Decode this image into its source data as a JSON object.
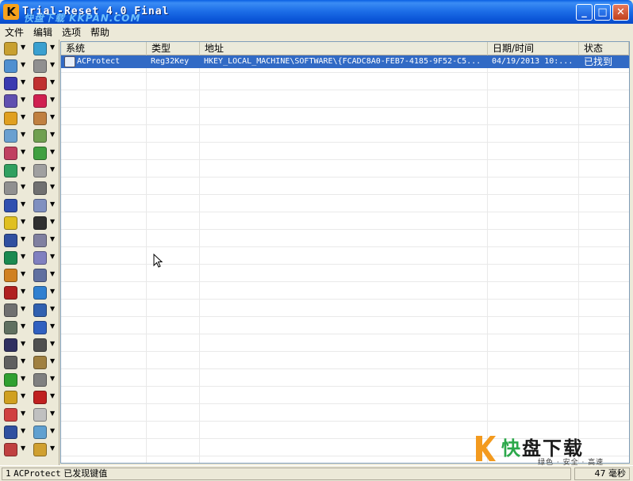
{
  "window": {
    "title": "Trial-Reset 4.0 Final",
    "watermark": "快盘下载 KKPAN.COM",
    "controls": {
      "minimize": "_",
      "maximize": "□",
      "close": "✕"
    }
  },
  "menu": [
    "文件",
    "编辑",
    "选项",
    "帮助"
  ],
  "toolbar": {
    "icon_colors": [
      "#c8a030",
      "#3aa0d0",
      "#5090d0",
      "#909090",
      "#3a3ab0",
      "#c03030",
      "#6050b0",
      "#d02050",
      "#e0a020",
      "#c08040",
      "#6aa0d0",
      "#70a050",
      "#c04060",
      "#40a040",
      "#30a060",
      "#a0a0a0",
      "#909090",
      "#707070",
      "#3050b0",
      "#8090c0",
      "#e0c020",
      "#303030",
      "#3050a0",
      "#8080a0",
      "#1a8a50",
      "#8080c0",
      "#d08020",
      "#6070a0",
      "#b02020",
      "#3080d0",
      "#707070",
      "#3060b0",
      "#607060",
      "#3060c0",
      "#303060",
      "#505050",
      "#606060",
      "#a08040",
      "#30a030",
      "#808080",
      "#d0a020",
      "#c02020",
      "#d04040",
      "#c0c0c0",
      "#3050a0",
      "#60a0d0",
      "#c04040",
      "#d0a030"
    ]
  },
  "list": {
    "columns": [
      "系统",
      "类型",
      "地址",
      "日期/时间",
      "状态"
    ],
    "rows": [
      {
        "system": "ACProtect",
        "type": "Reg32Key",
        "address": "HKEY_LOCAL_MACHINE\\SOFTWARE\\{FCADC8A0-FEB7-4185-9F52-C5...",
        "datetime": "04/19/2013 10:...",
        "status": "已找到"
      }
    ]
  },
  "statusbar": {
    "count": "1",
    "program": "ACProtect",
    "message": "已发现键值",
    "timing": "47 毫秒"
  },
  "brand": {
    "name_char1": "快",
    "name_rest": "盘下载",
    "slogan": "绿色 · 安全 · 高速"
  }
}
